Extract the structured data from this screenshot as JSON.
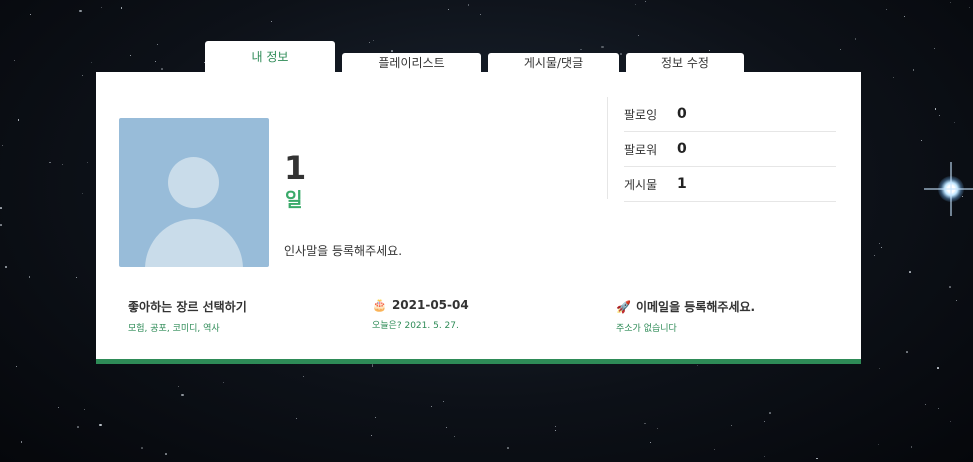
{
  "tabs": [
    {
      "label": "내 정보",
      "active": true
    },
    {
      "label": "플레이리스트",
      "active": false
    },
    {
      "label": "게시물/댓글",
      "active": false
    },
    {
      "label": "정보 수정",
      "active": false
    }
  ],
  "profile": {
    "days_count": "1",
    "days_unit": "일",
    "greeting": "인사말을 등록해주세요."
  },
  "stats": [
    {
      "label": "팔로잉",
      "value": "0"
    },
    {
      "label": "팔로워",
      "value": "0"
    },
    {
      "label": "게시물",
      "value": "1"
    }
  ],
  "genre": {
    "title": "좋아하는 장르 선택하기",
    "list": "모험, 공포, 코미디, 역사"
  },
  "birthday": {
    "icon": "cake-icon",
    "date": "2021-05-04",
    "sub": "오늘은? 2021. 5. 27."
  },
  "email": {
    "icon": "rocket-icon",
    "title": "이메일을 등록해주세요.",
    "sub": "주소가 없습니다"
  },
  "colors": {
    "accent": "#2e8b57",
    "avatar_bg": "#98bcd9"
  }
}
